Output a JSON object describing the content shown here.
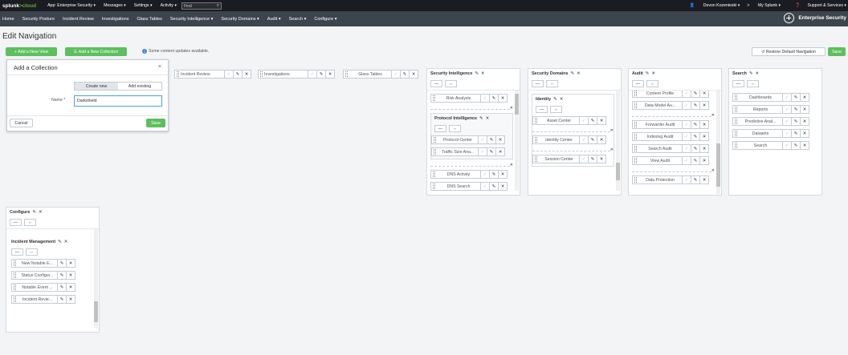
{
  "topbar": {
    "logo_main": "splunk",
    "logo_accent": ">cloud",
    "menus": [
      "App: Enterprise Security ▾",
      "Messages ▾",
      "Settings ▾",
      "Activity ▾"
    ],
    "find_placeholder": "Find",
    "right_items": [
      "Devon Kozenieski ▾",
      "My Splunk ▾",
      "Support & Services ▾"
    ]
  },
  "appbar": {
    "nav": [
      "Home",
      "Security Posture",
      "Incident Review",
      "Investigations",
      "Glass Tables",
      "Security Intelligence ▾",
      "Security Domains ▾",
      "Audit ▾",
      "Search ▾",
      "Configure ▾"
    ],
    "app_title": "Enterprise Security"
  },
  "page": {
    "title": "Edit Navigation",
    "add_view": "Add a New View",
    "add_collection": "Add a New Collection",
    "updates": "Some content updates available.",
    "restore": "Restore Default Navigation",
    "save": "Save"
  },
  "views": [
    "Incident Review",
    "Investigations",
    "Glass Tables"
  ],
  "collections": {
    "security_intelligence": {
      "title": "Security Intelligence",
      "items": [
        "Risk Analysis"
      ],
      "sub_title": "Protocol Intelligence",
      "sub_items": [
        "Protocol Center",
        "Traffic Size Ana..."
      ],
      "after_items": [
        "DNS Activity",
        "DNS Search"
      ]
    },
    "security_domains": {
      "title": "Security Domains",
      "sub_title": "Identity",
      "sub_items": [
        "Asset Center",
        "Identity Center",
        "Session Center"
      ]
    },
    "audit": {
      "title": "Audit",
      "items_top": [
        "Content Profile",
        "Data Model Au..."
      ],
      "items_mid": [
        "Forwarder Audit",
        "Indexing Audit",
        "Search Audit",
        "View Audit"
      ],
      "items_bottom": [
        "Data Protection"
      ]
    },
    "search": {
      "title": "Search",
      "items": [
        "Dashboards",
        "Reports",
        "Predictive Anal...",
        "Datasets",
        "Search"
      ]
    },
    "configure": {
      "title": "Configure",
      "sub_title": "Incident Management",
      "sub_items": [
        "New Notable E...",
        "Status Configur...",
        "Notable Event ...",
        "Incident Revie..."
      ]
    }
  },
  "modal": {
    "title": "Add a Collection",
    "tab_new": "Create new",
    "tab_existing": "Add existing",
    "name_label": "Name *",
    "name_value": "Darkshield",
    "cancel": "Cancel",
    "save": "Save"
  },
  "colors": {
    "accent_green": "#5cc05c",
    "topbar": "#1a1c21",
    "appbar": "#3c444d"
  }
}
